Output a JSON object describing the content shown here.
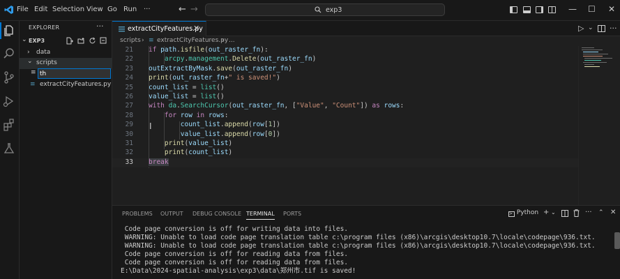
{
  "colors": {
    "accent": "#0078d4",
    "keyword": "#569cd6",
    "control": "#c586c0",
    "function": "#dcdcaa",
    "variable": "#9cdcfe",
    "string": "#ce9178",
    "number": "#b5cea8",
    "type": "#4ec9b0"
  },
  "titlebar": {
    "menu": [
      "File",
      "Edit",
      "Selection",
      "View",
      "Go",
      "Run",
      "···"
    ],
    "search_text": "exp3",
    "window_controls": [
      "—",
      "☐",
      "✕"
    ]
  },
  "sidebar": {
    "title": "EXPLORER",
    "project": "EXP3",
    "tree": [
      {
        "label": "data",
        "chevron": "›"
      },
      {
        "label": "scripts",
        "chevron": "⌄"
      },
      {
        "label": "extractCityFeatures.py",
        "icon": "≡"
      }
    ],
    "rename_value": "th"
  },
  "editor": {
    "tab_label": "extractCityFeatures.py",
    "breadcrumb": [
      "scripts",
      "›",
      "extractCityFeatures.py",
      "›",
      "..."
    ],
    "lines": [
      {
        "n": "21",
        "indent": 4,
        "tokens": [
          [
            "if ",
            "control"
          ],
          [
            "path",
            "variable"
          ],
          [
            ".",
            "plain"
          ],
          [
            "isfile",
            "function"
          ],
          [
            "(",
            "plain"
          ],
          [
            "out_raster_fn",
            "variable"
          ],
          [
            "):",
            "plain"
          ]
        ]
      },
      {
        "n": "22",
        "indent": 8,
        "tokens": [
          [
            "arcpy",
            "type"
          ],
          [
            ".",
            "plain"
          ],
          [
            "management",
            "type"
          ],
          [
            ".",
            "plain"
          ],
          [
            "Delete",
            "function"
          ],
          [
            "(",
            "plain"
          ],
          [
            "out_raster_fn",
            "variable"
          ],
          [
            ")",
            "plain"
          ]
        ]
      },
      {
        "n": "23",
        "indent": 4,
        "tokens": [
          [
            "outExtractByMask",
            "variable"
          ],
          [
            ".",
            "plain"
          ],
          [
            "save",
            "function"
          ],
          [
            "(",
            "plain"
          ],
          [
            "out_raster_fn",
            "variable"
          ],
          [
            ")",
            "plain"
          ]
        ]
      },
      {
        "n": "24",
        "indent": 4,
        "tokens": [
          [
            "print",
            "function"
          ],
          [
            "(",
            "plain"
          ],
          [
            "out_raster_fn",
            "variable"
          ],
          [
            "+",
            "plain"
          ],
          [
            "\" is saved!\"",
            "string"
          ],
          [
            ")",
            "plain"
          ]
        ]
      },
      {
        "n": "25",
        "indent": 4,
        "tokens": [
          [
            "count_list",
            "variable"
          ],
          [
            " = ",
            "plain"
          ],
          [
            "list",
            "type"
          ],
          [
            "()",
            "plain"
          ]
        ]
      },
      {
        "n": "26",
        "indent": 4,
        "tokens": [
          [
            "value_list",
            "variable"
          ],
          [
            " = ",
            "plain"
          ],
          [
            "list",
            "type"
          ],
          [
            "()",
            "plain"
          ]
        ]
      },
      {
        "n": "27",
        "indent": 4,
        "tokens": [
          [
            "with ",
            "control"
          ],
          [
            "da",
            "type"
          ],
          [
            ".",
            "plain"
          ],
          [
            "SearchCursor",
            "type"
          ],
          [
            "(",
            "plain"
          ],
          [
            "out_raster_fn",
            "variable"
          ],
          [
            ", [",
            "plain"
          ],
          [
            "\"Value\"",
            "string"
          ],
          [
            ", ",
            "plain"
          ],
          [
            "\"Count\"",
            "string"
          ],
          [
            "]) ",
            "plain"
          ],
          [
            "as ",
            "control"
          ],
          [
            "rows",
            "variable"
          ],
          [
            ":",
            "plain"
          ]
        ]
      },
      {
        "n": "28",
        "indent": 8,
        "tokens": [
          [
            "for ",
            "control"
          ],
          [
            "row ",
            "variable"
          ],
          [
            "in ",
            "control"
          ],
          [
            "rows",
            "variable"
          ],
          [
            ":",
            "plain"
          ]
        ]
      },
      {
        "n": "29",
        "indent": 12,
        "tokens": [
          [
            "count_list",
            "variable"
          ],
          [
            ".",
            "plain"
          ],
          [
            "append",
            "function"
          ],
          [
            "(",
            "plain"
          ],
          [
            "row",
            "variable"
          ],
          [
            "[",
            "plain"
          ],
          [
            "1",
            "number"
          ],
          [
            "])",
            "plain"
          ]
        ]
      },
      {
        "n": "30",
        "indent": 12,
        "tokens": [
          [
            "value_list",
            "variable"
          ],
          [
            ".",
            "plain"
          ],
          [
            "append",
            "function"
          ],
          [
            "(",
            "plain"
          ],
          [
            "row",
            "variable"
          ],
          [
            "[",
            "plain"
          ],
          [
            "0",
            "number"
          ],
          [
            "])",
            "plain"
          ]
        ]
      },
      {
        "n": "31",
        "indent": 8,
        "tokens": [
          [
            "print",
            "function"
          ],
          [
            "(",
            "plain"
          ],
          [
            "value_list",
            "variable"
          ],
          [
            ")",
            "plain"
          ]
        ]
      },
      {
        "n": "32",
        "indent": 8,
        "tokens": [
          [
            "print",
            "function"
          ],
          [
            "(",
            "plain"
          ],
          [
            "count_list",
            "variable"
          ],
          [
            ")",
            "plain"
          ]
        ]
      },
      {
        "n": "33",
        "indent": 4,
        "tokens": [
          [
            "break",
            "control"
          ]
        ]
      }
    ]
  },
  "panel": {
    "tabs": [
      "PROBLEMS",
      "OUTPUT",
      "DEBUG CONSOLE",
      "TERMINAL",
      "PORTS"
    ],
    "active_tab": "TERMINAL",
    "terminal_profile": "Python",
    "terminal_lines": [
      " Code page conversion is off for writing data into files.",
      " WARNING: Unable to load code page translation table c:\\program files (x86)\\arcgis\\desktop10.7\\locale\\codepage\\936.txt.",
      " WARNING: Unable to load code page translation table c:\\program files (x86)\\arcgis\\desktop10.7\\locale\\codepage\\936.txt.",
      " Code page conversion is off for reading data from files.",
      " Code page conversion is off for reading data from files.",
      "E:\\Data\\2024-spatial-analysis\\exp3\\data\\郑州市.tif is saved!"
    ]
  }
}
